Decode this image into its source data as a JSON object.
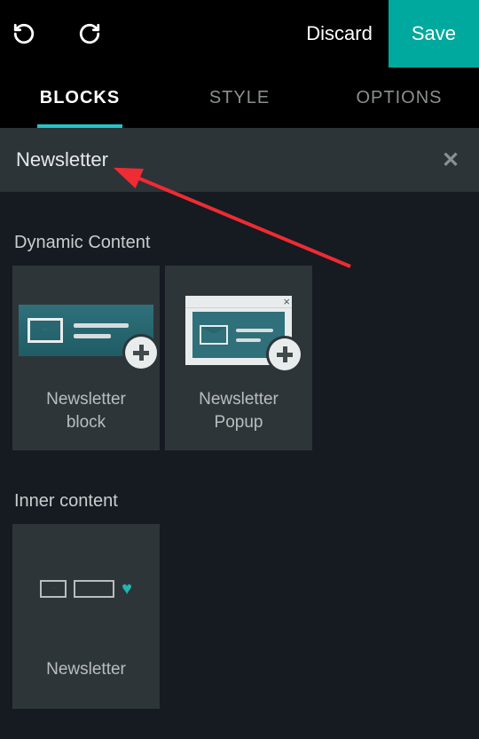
{
  "toolbar": {
    "discard_label": "Discard",
    "save_label": "Save"
  },
  "tabs": {
    "blocks": "BLOCKS",
    "style": "STYLE",
    "options": "OPTIONS",
    "active": "blocks"
  },
  "search": {
    "value": "Newsletter"
  },
  "sections": [
    {
      "title": "Dynamic Content",
      "items": [
        {
          "label": "Newsletter block"
        },
        {
          "label": "Newsletter Popup"
        }
      ]
    },
    {
      "title": "Inner content",
      "items": [
        {
          "label": "Newsletter"
        }
      ]
    }
  ],
  "colors": {
    "accent": "#00a99d",
    "tab_underline": "#25c3c9"
  }
}
